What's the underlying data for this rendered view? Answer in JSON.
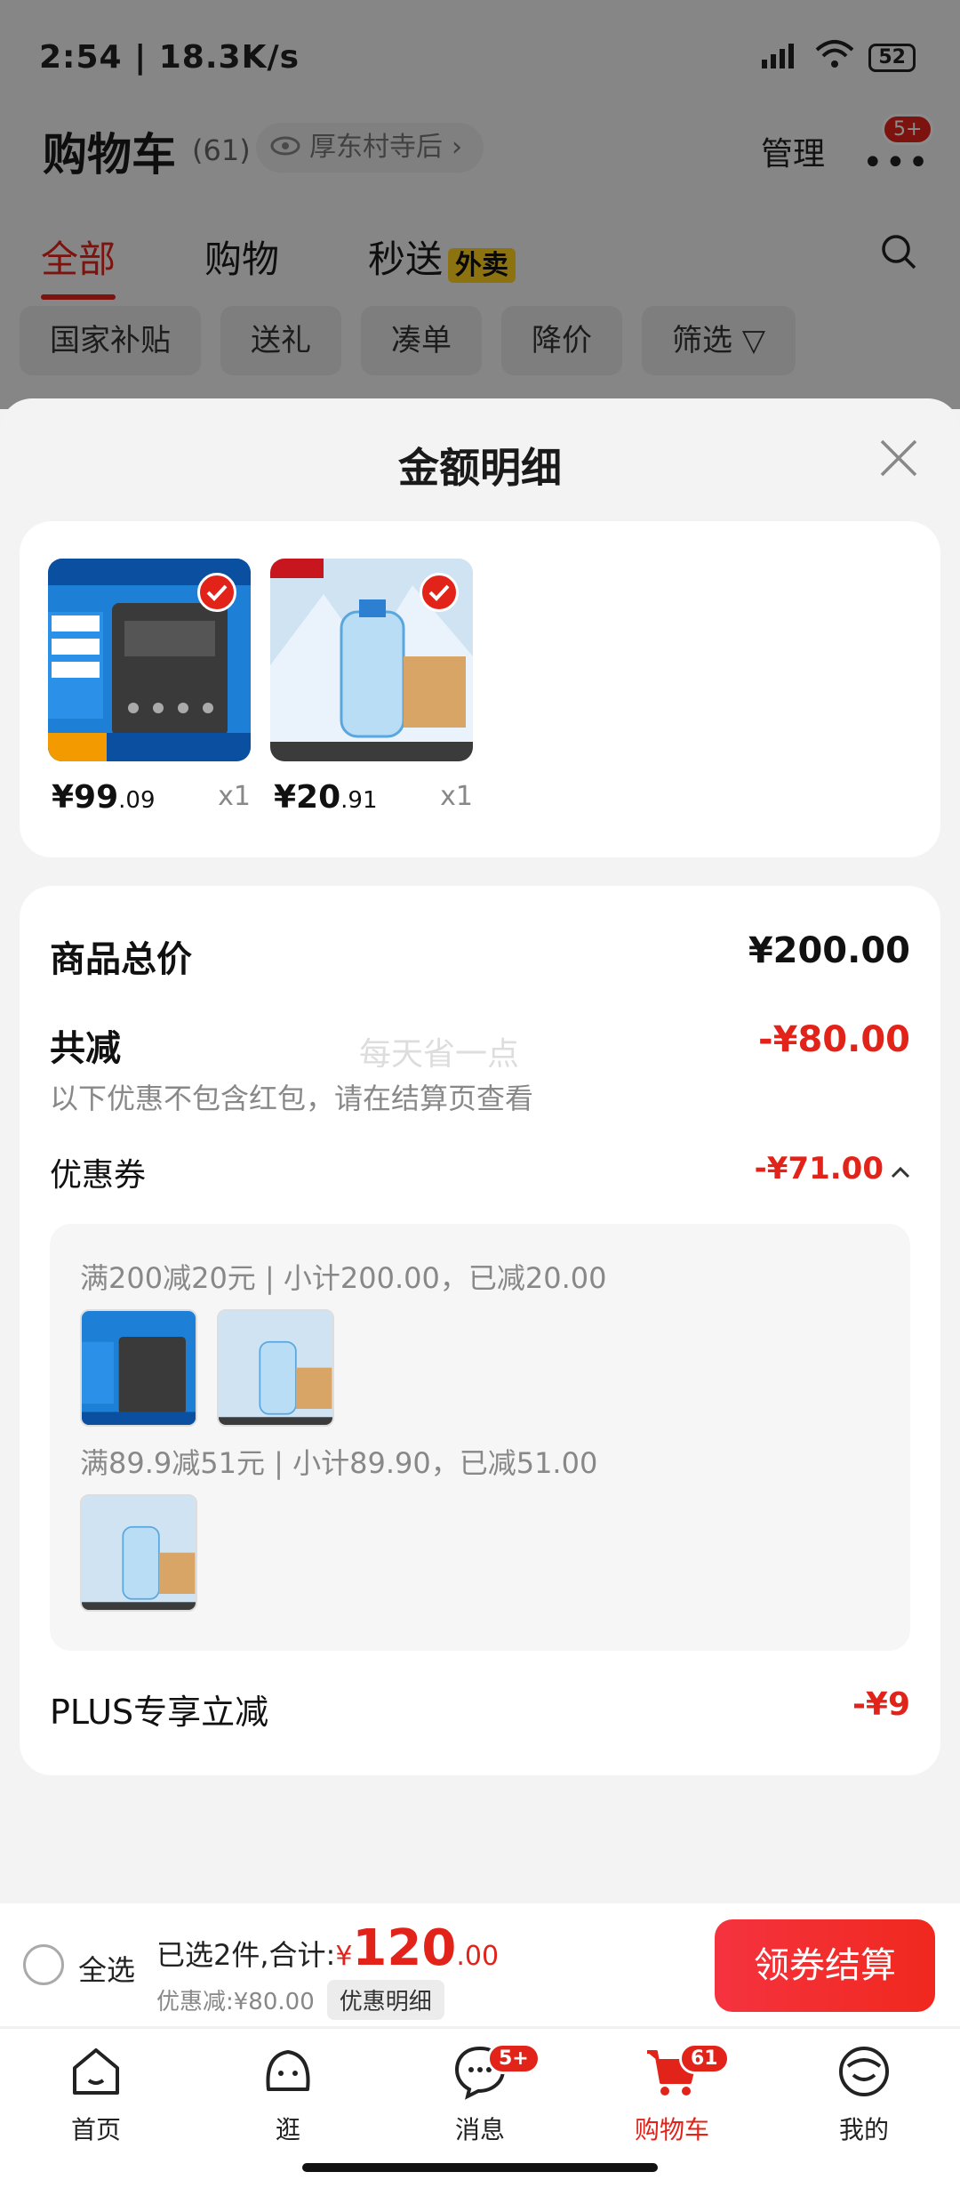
{
  "status_bar": {
    "time": "2:54 | 18.3K/s",
    "battery": "52"
  },
  "header": {
    "title": "购物车",
    "count": "(61)",
    "address": "厚东村寺后",
    "manage": "管理",
    "more_badge": "5+"
  },
  "tabs": {
    "all": "全部",
    "shopping": "购物",
    "flash": "秒送",
    "waimai": "外卖"
  },
  "chips": [
    "国家补贴",
    "送礼",
    "凑单",
    "降价",
    "筛选"
  ],
  "sheet": {
    "title": "金额明细",
    "items": [
      {
        "price_int": "¥99",
        "price_dec": ".09",
        "qty": "x1",
        "thumb": "contactor-product"
      },
      {
        "price_int": "¥20",
        "price_dec": ".91",
        "qty": "x1",
        "thumb": "water-product"
      }
    ],
    "total_label": "商品总价",
    "total_value": "¥200.00",
    "reduce_label": "共减",
    "reduce_value": "-¥80.00",
    "watermark": "每天省一点",
    "reduce_note": "以下优惠不包含红包，请在结算页查看",
    "coupon_label": "优惠券",
    "coupon_value": "-¥71.00",
    "coupon_line1": "满200减20元 | 小计200.00，已减20.00",
    "coupon_line2": "满89.9减51元 | 小计89.90，已减51.00",
    "plus_label": "PLUS专享立减",
    "plus_value": "-¥9"
  },
  "checkout": {
    "select_all": "全选",
    "summary": "已选2件,合计:",
    "yen": "¥",
    "total_int": "120",
    "total_dec": ".00",
    "discount": "优惠减:¥80.00",
    "detail_button": "优惠明细",
    "pay_button": "领券结算"
  },
  "tabbar": {
    "home": "首页",
    "browse": "逛",
    "messages": "消息",
    "messages_badge": "5+",
    "cart": "购物车",
    "cart_badge": "61",
    "me": "我的"
  },
  "colors": {
    "accent": "#e2231a"
  }
}
